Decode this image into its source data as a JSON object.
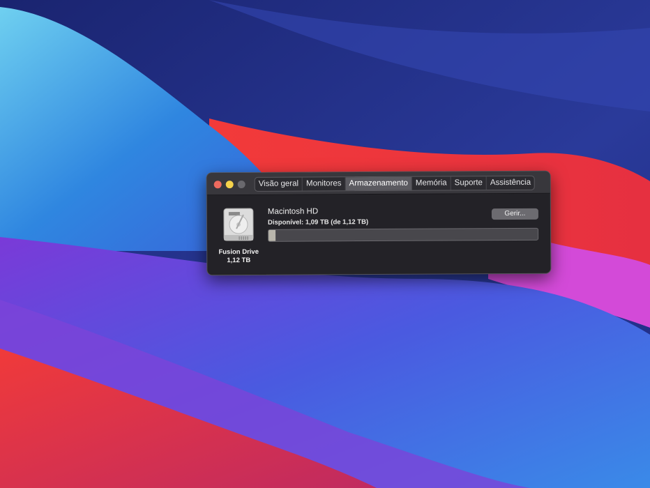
{
  "window": {
    "tabs": [
      {
        "label": "Visão geral",
        "active": false
      },
      {
        "label": "Monitores",
        "active": false
      },
      {
        "label": "Armazenamento",
        "active": true
      },
      {
        "label": "Memória",
        "active": false
      },
      {
        "label": "Suporte",
        "active": false
      },
      {
        "label": "Assistência",
        "active": false
      }
    ],
    "disk": {
      "type": "Fusion Drive",
      "capacity": "1,12 TB"
    },
    "volume": {
      "name": "Macintosh HD",
      "available": "Disponível: 1,09 TB (de 1,12 TB)",
      "used_fraction": 0.027
    },
    "manage_label": "Gerir..."
  }
}
